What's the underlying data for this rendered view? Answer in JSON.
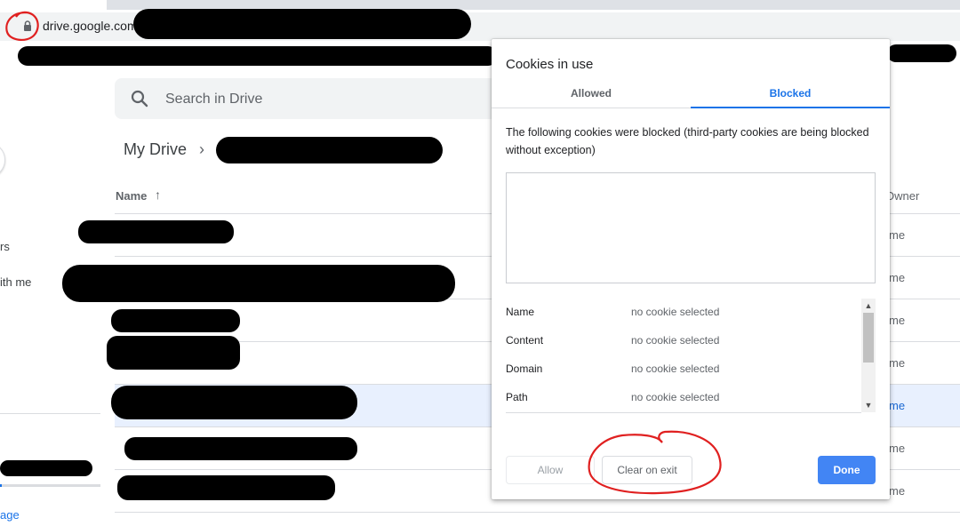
{
  "browser": {
    "url": "drive.google.com/"
  },
  "drive": {
    "search_placeholder": "Search in Drive",
    "breadcrumb_root": "My Drive",
    "breadcrumb_separator": "›",
    "columns": {
      "name": "Name",
      "sort_arrow": "↑",
      "owner": "Owner"
    },
    "row_owner_values": [
      "me",
      "me",
      "me",
      "me",
      "me",
      "me",
      "me"
    ],
    "sidebar": {
      "item1_partial": "rs",
      "item2_partial": "ith me",
      "link_partial": "age"
    }
  },
  "dialog": {
    "title": "Cookies in use",
    "tabs": {
      "allowed": "Allowed",
      "blocked": "Blocked",
      "active": "blocked"
    },
    "description": "The following cookies were blocked (third-party cookies are being blocked without exception)",
    "details": [
      {
        "label": "Name",
        "value": "no cookie selected"
      },
      {
        "label": "Content",
        "value": "no cookie selected"
      },
      {
        "label": "Domain",
        "value": "no cookie selected"
      },
      {
        "label": "Path",
        "value": "no cookie selected"
      }
    ],
    "buttons": {
      "allow": "Allow",
      "clear_on_exit": "Clear on exit",
      "done": "Done"
    }
  },
  "colors": {
    "accent": "#1a73e8",
    "done_button": "#4285f4",
    "selected_row": "#e8f0fe",
    "annotation": "#e02020"
  }
}
